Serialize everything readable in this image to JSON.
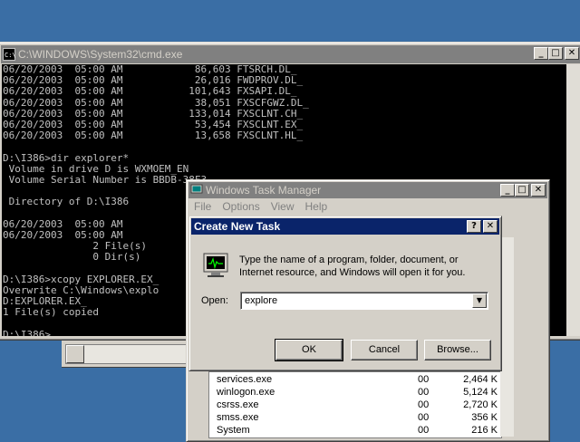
{
  "cmd": {
    "title": "C:\\WINDOWS\\System32\\cmd.exe",
    "lines": [
      "06/20/2003  05:00 AM            86,603 FTSRCH.DL_",
      "06/20/2003  05:00 AM            26,016 FWDPROV.DL_",
      "06/20/2003  05:00 AM           101,643 FXSAPI.DL_",
      "06/20/2003  05:00 AM            38,051 FXSCFGWZ.DL_",
      "06/20/2003  05:00 AM           133,014 FXSCLNT.CH_",
      "06/20/2003  05:00 AM            53,454 FXSCLNT.EX_",
      "06/20/2003  05:00 AM            13,658 FXSCLNT.HL_",
      "",
      "D:\\I386>dir explorer*",
      " Volume in drive D is WXMOEM_EN",
      " Volume Serial Number is BBDB-38F3",
      "",
      " Directory of D:\\I386",
      "",
      "06/20/2003  05:00 AM",
      "06/20/2003  05:00 AM",
      "               2 File(s)",
      "               0 Dir(s)",
      "",
      "D:\\I386>xcopy EXPLORER.EX_",
      "Overwrite C:\\Windows\\explo",
      "D:EXPLORER.EX_",
      "1 File(s) copied",
      "",
      "D:\\I386>"
    ]
  },
  "taskmgr": {
    "title": "Windows Task Manager",
    "menu": [
      "File",
      "Options",
      "View",
      "Help"
    ],
    "processes": [
      {
        "name": "services.exe",
        "cpu": "00",
        "mem": "2,464 K"
      },
      {
        "name": "winlogon.exe",
        "cpu": "00",
        "mem": "5,124 K"
      },
      {
        "name": "csrss.exe",
        "cpu": "00",
        "mem": "2,720 K"
      },
      {
        "name": "smss.exe",
        "cpu": "00",
        "mem": "356 K"
      },
      {
        "name": "System",
        "cpu": "00",
        "mem": "216 K"
      }
    ]
  },
  "dialog": {
    "title": "Create New Task",
    "description": "Type the name of a program, folder, document, or Internet resource, and Windows will open it for you.",
    "open_label": "Open:",
    "open_value": "explore",
    "ok_label": "OK",
    "cancel_label": "Cancel",
    "browse_label": "Browse..."
  }
}
